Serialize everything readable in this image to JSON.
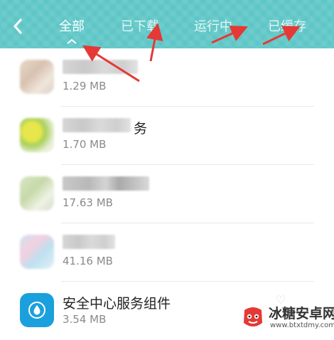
{
  "header": {
    "tabs": [
      {
        "label": "全部",
        "active": true
      },
      {
        "label": "已下载",
        "active": false
      },
      {
        "label": "运行中",
        "active": false
      },
      {
        "label": "已缓存",
        "active": false
      }
    ]
  },
  "apps": [
    {
      "name": "",
      "size": "1.29 MB",
      "blurred": true
    },
    {
      "name": "务",
      "size": "1.70 MB",
      "blurred": true
    },
    {
      "name": "",
      "size": "17.63 MB",
      "blurred": true
    },
    {
      "name": "",
      "size": "41.16 MB",
      "blurred": true
    },
    {
      "name": "安全中心服务组件",
      "size": "3.54 MB",
      "blurred": false
    }
  ],
  "watermark": {
    "title": "冰糖安卓网",
    "url": "www.btxtdmy.com"
  },
  "colors": {
    "header": "#5ec6c6",
    "arrow": "#e53935",
    "security_icon": "#1aa0dc"
  }
}
